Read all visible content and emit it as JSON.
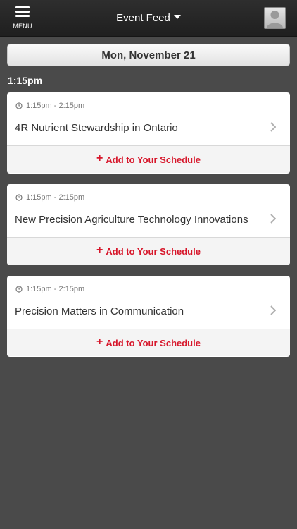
{
  "header": {
    "menu_label": "MENU",
    "title": "Event Feed",
    "icons": {
      "menu": "hamburger-icon",
      "dropdown": "caret-down-icon",
      "profile": "user-avatar-icon"
    }
  },
  "date_label": "Mon, November 21",
  "time_group": "1:15pm",
  "events": [
    {
      "time": "1:15pm - 2:15pm",
      "title": "4R Nutrient Stewardship in Ontario",
      "action": "Add to Your Schedule",
      "action_icon": "+"
    },
    {
      "time": "1:15pm - 2:15pm",
      "title": "New Precision Agriculture Technology Innovations",
      "action": "Add to Your Schedule",
      "action_icon": "+"
    },
    {
      "time": "1:15pm - 2:15pm",
      "title": "Precision Matters in Communication",
      "action": "Add to Your Schedule",
      "action_icon": "+"
    }
  ],
  "colors": {
    "background": "#4a4a4a",
    "topbar": "#252525",
    "action_red": "#d7172b",
    "card": "#ffffff"
  }
}
